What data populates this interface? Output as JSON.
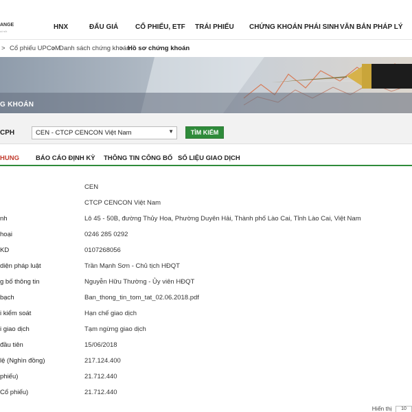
{
  "logo": {
    "text": "ANGE",
    "sub": "HÀ NỘI"
  },
  "nav": {
    "items": [
      "HNX",
      "ĐẤU GIÁ",
      "CỔ PHIẾU, ETF",
      "TRÁI PHIẾU",
      "CHỨNG KHOÁN PHÁI SINH",
      "VĂN BẢN PHÁP LÝ"
    ]
  },
  "breadcrumb": {
    "sep": ">",
    "items": [
      "Cổ phiếu UPCoM",
      "Danh sách chứng khoán"
    ],
    "current": "Hồ sơ chứng khoán"
  },
  "banner": {
    "title": "G KHOÁN"
  },
  "search": {
    "label": "CPH",
    "selected": "CEN - CTCP CENCON Việt Nam",
    "button": "TÌM KIẾM"
  },
  "tabs": [
    "HUNG",
    "BÁO CÁO ĐỊNH KỲ",
    "THÔNG TIN CÔNG BỐ",
    "SỐ LIỆU GIAO DỊCH"
  ],
  "info_rows": [
    {
      "label": "",
      "value": "CEN"
    },
    {
      "label": "",
      "value": "CTCP CENCON Việt Nam"
    },
    {
      "label": "nh",
      "value": "Lô 45 - 50B, đường Thủy Hoa, Phường Duyên Hải, Thành phố Lào Cai, Tỉnh Lào Cai, Việt Nam"
    },
    {
      "label": "hoại",
      "value": "0246 285 0292"
    },
    {
      "label": "KD",
      "value": "0107268056"
    },
    {
      "label": "diện pháp luật",
      "value": "Trần Mạnh Sơn - Chủ tịch HĐQT"
    },
    {
      "label": "g bố thông tin",
      "value": "Nguyễn Hữu Thường - Ủy viên HĐQT"
    },
    {
      "label": "bạch",
      "value": "Ban_thong_tin_tom_tat_02.06.2018.pdf"
    },
    {
      "label": "i kiểm soát",
      "value": "Hạn chế giao dịch"
    },
    {
      "label": "i giao dịch",
      "value": "Tạm ngừng giao dịch"
    },
    {
      "label": "đầu tiên",
      "value": "15/06/2018"
    },
    {
      "label": "lệ (Nghìn đồng)",
      "value": "217.124.400"
    },
    {
      "label": "phiếu)",
      "value": "21.712.440"
    },
    {
      "label": "Cổ phiếu)",
      "value": "21.712.440"
    }
  ],
  "pager": {
    "label": "Hiển thị",
    "value": "10"
  },
  "colors": {
    "accent": "#2e8b3a",
    "active_tab": "#c0392b"
  }
}
